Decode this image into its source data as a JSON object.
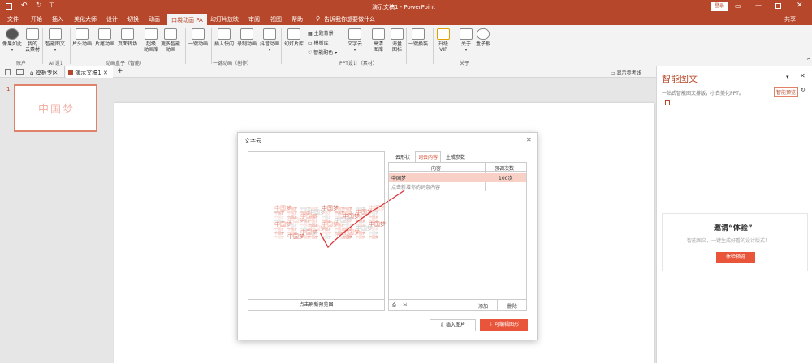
{
  "titlebar": {
    "title": "演示文稿1  -  PowerPoint",
    "login": "登录",
    "colors": {
      "accent": "#b7472a"
    }
  },
  "tabs": [
    "文件",
    "开始",
    "插入",
    "美化大师",
    "设计",
    "切换",
    "动画",
    "口袋动画 PA",
    "幻灯片放映",
    "审阅",
    "视图",
    "帮助"
  ],
  "tell_me": "告诉我你想要做什么",
  "share": "共享",
  "ribbon": {
    "buttons": [
      {
        "label": "像果如此",
        "sub": "▾"
      },
      {
        "label": "我的",
        "sub": "云素材"
      },
      {
        "label": "智能图文",
        "sub": "▾"
      },
      {
        "label": "片头动画",
        "sub": ""
      },
      {
        "label": "片尾动画",
        "sub": ""
      },
      {
        "label": "页面转场",
        "sub": ""
      },
      {
        "label": "超级",
        "sub": "动画库"
      },
      {
        "label": "更多智能",
        "sub": "动画"
      },
      {
        "label": "一键动画",
        "sub": ""
      },
      {
        "label": "插入快闪",
        "sub": ""
      },
      {
        "label": "录制动画",
        "sub": ""
      },
      {
        "label": "抖音动画",
        "sub": "▾"
      },
      {
        "label": "幻灯片库",
        "sub": ""
      },
      {
        "label": "文字云",
        "sub": "▾"
      },
      {
        "label": "高清",
        "sub": "图库"
      },
      {
        "label": "海量",
        "sub": "图标"
      },
      {
        "label": "一键换装",
        "sub": ""
      },
      {
        "label": "升级",
        "sub": "VIP"
      },
      {
        "label": "关于",
        "sub": "▾"
      },
      {
        "label": "盒子板",
        "sub": ""
      }
    ],
    "small": [
      "主题背景",
      "模板库",
      "智能配色 ▾"
    ],
    "groups": [
      "账户",
      "AI 设计",
      "动画盒子（智能）",
      "一键动画（创作）",
      "PPT设计（素材）",
      "关于"
    ]
  },
  "doctabs": {
    "tab1": "模板专区",
    "tab2": "演示文稿1",
    "add": "+",
    "right": "显示参考线"
  },
  "thumb": {
    "number": "1",
    "text": "中国梦"
  },
  "dialog": {
    "title": "文字云",
    "close": "✕",
    "tabs": [
      "云形状",
      "词云内容",
      "生成参数"
    ],
    "table": {
      "headers": [
        "内容",
        "强调次数"
      ],
      "rows": [
        [
          "中国梦",
          "100次"
        ],
        [
          "点击新增你的词条内容",
          ""
        ]
      ]
    },
    "preview_link": "点击刷新预览图",
    "footer_add": "添加",
    "footer_delete": "删除",
    "btn_insert": "插入图片",
    "btn_edit": "可编辑图形",
    "cloud_word": "中国梦"
  },
  "rightpane": {
    "title": "智能图文",
    "subtitle": "一站式智能图文排版，小白美化PPT。",
    "preview": "智能预览",
    "invite_title": "邀请“体验”",
    "invite_desc": "智能图文，一键生成好看的设计版式！",
    "invite_btn": "体验预览"
  }
}
